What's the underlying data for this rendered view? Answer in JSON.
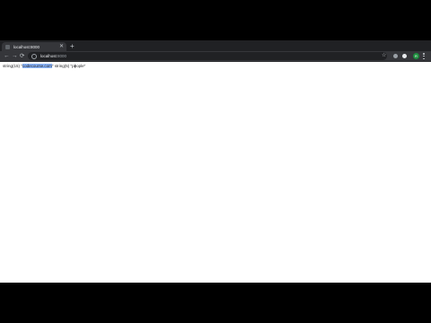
{
  "tab": {
    "title": "localhost:8000",
    "close_glyph": "✕"
  },
  "new_tab_glyph": "+",
  "toolbar": {
    "back_glyph": "←",
    "forward_glyph": "→",
    "reload_glyph": "⟳",
    "star_glyph": "☆",
    "url_host": "localhost",
    "url_port": ":8000",
    "avatar_letter": "R"
  },
  "extensions": [
    {
      "name": "extension-icon-1",
      "color": "#9aa0a6"
    },
    {
      "name": "extension-icon-2",
      "color": "#e8eaed"
    }
  ],
  "output": {
    "prefix": "string(15) \"",
    "selected": "codecourse.com",
    "middle": "\" string(5) \"people\""
  }
}
